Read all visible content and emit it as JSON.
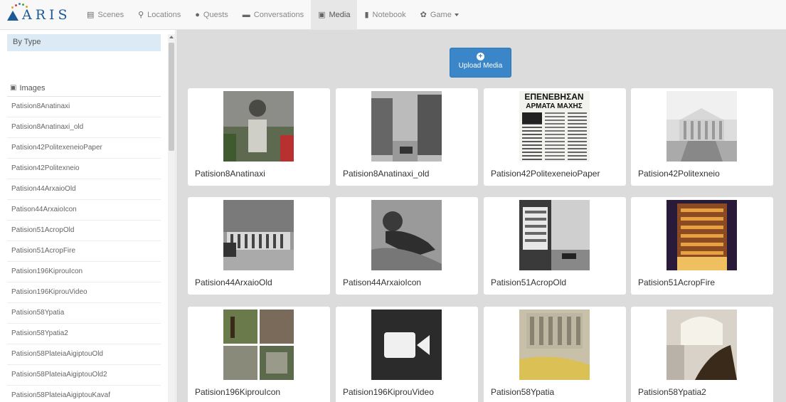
{
  "brand": {
    "name": "ARIS",
    "color": "#1a5a96"
  },
  "nav": [
    {
      "label": "Scenes",
      "icon": "film-icon"
    },
    {
      "label": "Locations",
      "icon": "map-marker-icon"
    },
    {
      "label": "Quests",
      "icon": "exclamation-circle-icon"
    },
    {
      "label": "Conversations",
      "icon": "comment-icon"
    },
    {
      "label": "Media",
      "icon": "picture-icon",
      "active": true
    },
    {
      "label": "Notebook",
      "icon": "book-icon"
    },
    {
      "label": "Game",
      "icon": "gear-icon",
      "dropdown": true
    }
  ],
  "sidebar": {
    "by_type": "By Type",
    "section_title": "Images",
    "items": [
      "Patision8Anatinaxi",
      "Patision8Anatinaxi_old",
      "Patision42PolitexeneioPaper",
      "Patision42Politexneio",
      "Patision44ArxaioOld",
      "Patison44ArxaioIcon",
      "Patision51AcropOld",
      "Patision51AcropFire",
      "Patision196KiprouIcon",
      "Patision196KiprouVideo",
      "Patision58Ypatia",
      "Patision58Ypatia2",
      "Patision58PlateiaAigiptouOld",
      "Patision58PlateiaAigiptouOld2",
      "Patision58PlateiaAigiptouKavaf"
    ]
  },
  "main": {
    "upload_label": "Upload Media",
    "accent": "#3a86c8",
    "cards": [
      {
        "caption": "Patision8Anatinaxi",
        "thumb": "statue"
      },
      {
        "caption": "Patision8Anatinaxi_old",
        "thumb": "street"
      },
      {
        "caption": "Patision42PolitexeneioPaper",
        "thumb": "newspaper",
        "headline": "ΕΠΕΝΕΒΗΣΑΝ\nΑΡΜΑΤΑ ΜΑΧΗΣ"
      },
      {
        "caption": "Patision42Politexneio",
        "thumb": "building"
      },
      {
        "caption": "Patision44ArxaioOld",
        "thumb": "museum"
      },
      {
        "caption": "Patison44ArxaioIcon",
        "thumb": "sculpture"
      },
      {
        "caption": "Patision51AcropOld",
        "thumb": "street2"
      },
      {
        "caption": "Patision51AcropFire",
        "thumb": "fire"
      },
      {
        "caption": "Patision196KiprouIcon",
        "thumb": "collage"
      },
      {
        "caption": "Patision196KiprouVideo",
        "thumb": "video"
      },
      {
        "caption": "Patision58Ypatia",
        "thumb": "blur"
      },
      {
        "caption": "Patision58Ypatia2",
        "thumb": "stairs"
      }
    ]
  }
}
